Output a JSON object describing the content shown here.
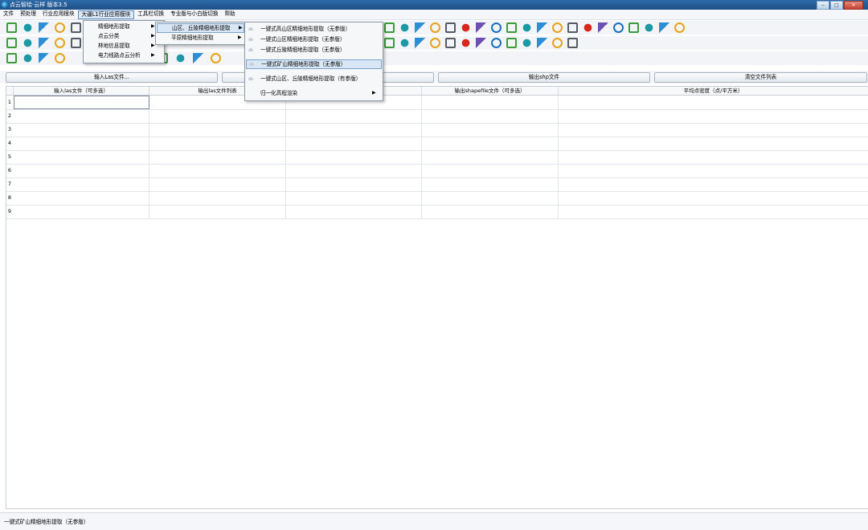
{
  "window": {
    "title": "点云智绘·云样 版本3.5",
    "min": "‒",
    "max": "□",
    "close": "✕"
  },
  "menubar": [
    "文件",
    "预处理",
    "行业应用模块",
    "大疆L1行业应用模块",
    "工具栏切换",
    "专业版与小白版切换",
    "帮助"
  ],
  "menu1": {
    "items": [
      "精细地形提取",
      "点云分类",
      "林地信息提取",
      "电力线路点云分析"
    ]
  },
  "menu2": {
    "items": [
      "山区、丘陵精细地形提取",
      "平原精细地形提取"
    ]
  },
  "menu3": {
    "items": [
      "一键式高山区精细地形提取（无参版）",
      "一键式山区精细地形提取（无参版）",
      "一键式丘陵精细地形提取（无参版）",
      "一键式矿山精细地形提取（无参版）",
      "一键式山区、丘陵精细地形提取（有参版）",
      "归一化高程渲染"
    ]
  },
  "actions": {
    "input_las": "输入Las文件...",
    "output_shp": "输出shp文件",
    "clear": "清空文件列表"
  },
  "table": {
    "headers": [
      "输入las文件（可多选）",
      "输出las文件列表",
      "",
      "输出shapefile文件（可多选）",
      "平均点密度（点/平方米）"
    ],
    "rows": [
      "1",
      "2",
      "3",
      "4",
      "5",
      "6",
      "7",
      "8",
      "9"
    ]
  },
  "status": {
    "text": "一键式矿山精细地形提取（无参版）"
  },
  "colors": {
    "titlebar": "#1d4f86",
    "highlight": "#d9e6f5",
    "accent_red": "#d7261e",
    "accent_blue": "#1a6fc0"
  },
  "icons": {
    "row1": [
      "open-file-icon",
      "import-icon",
      "export-icon",
      "copy-icon",
      "s-icon",
      "layers-icon",
      "folder-icon",
      "box-icon",
      "tri-icon",
      "mountain-icon",
      "dots-grid-icon",
      "grid-icon",
      "circle-icon",
      "scatter-icon",
      "person-icon",
      "warning-icon",
      "tree-person-icon",
      "pin-icon",
      "target-icon",
      "rect-icon",
      "hill-icon",
      "ruler-icon",
      "cross-circle-icon",
      "trend-icon",
      "globe-icon"
    ],
    "row2": [
      "eye-icon",
      "cone-icon",
      "frame-icon",
      "square-icon",
      "image-icon",
      "shape-icon",
      "curve-icon",
      "tree-icon",
      "tag-icon",
      "bars-icon",
      "ring-icon",
      "split-icon",
      "grid-dots-icon",
      "dots-icon",
      "leaf-icon",
      "house-icon",
      "pie-icon",
      "recycle-icon"
    ],
    "row3": [
      "zoom-icon",
      "cube-icon",
      "line-red-icon",
      "line-red2-icon",
      "road-icon",
      "pin-icon",
      "wing-icon",
      "heatmap-icon"
    ]
  }
}
